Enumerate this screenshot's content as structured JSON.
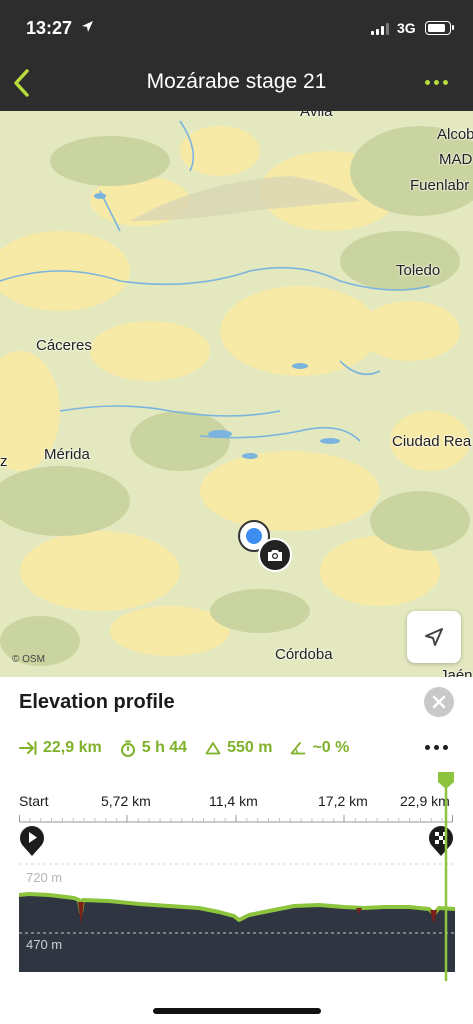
{
  "status_bar": {
    "time": "13:27",
    "network": "3G"
  },
  "nav": {
    "title": "Mozárabe stage 21"
  },
  "map": {
    "labels": {
      "avila": "Ávila",
      "alcob": "Alcob",
      "mad": "MAD",
      "fuenlabr": "Fuenlabr",
      "toledo": "Toledo",
      "caceres": "Cáceres",
      "merida": "Mérida",
      "ciudad_real": "Ciudad Rea",
      "cordoba": "Córdoba",
      "jaen": "Jaén",
      "z": "z"
    },
    "attribution": "© OSM"
  },
  "elevation_profile": {
    "title": "Elevation profile",
    "stats": {
      "distance": "22,9 km",
      "duration": "5 h 44",
      "ascent": "550 m",
      "gradient": "~0 %"
    },
    "axis": {
      "start": "Start",
      "tick1": "5,72 km",
      "tick2": "11,4 km",
      "tick3": "17,2 km",
      "end": "22,9 km"
    },
    "elevation_max": "720 m",
    "elevation_min": "470 m",
    "colors": {
      "accent": "#7fb12b",
      "profile_fill": "#2f3641",
      "line": "#8cc43d"
    }
  }
}
